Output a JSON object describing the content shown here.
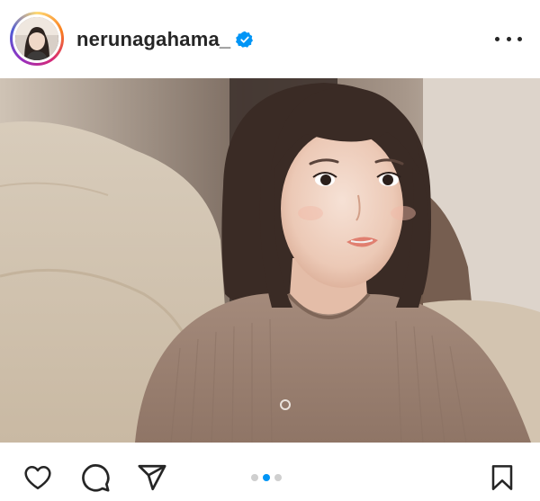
{
  "post": {
    "username": "nerunagahama_",
    "verified": true,
    "avatar_icon": "profile-avatar",
    "more_icon": "more-options-icon",
    "photo_description_icon": "post-photo"
  },
  "actions": {
    "like_icon": "heart-icon",
    "comment_icon": "comment-icon",
    "share_icon": "paper-plane-icon",
    "save_icon": "bookmark-icon"
  },
  "carousel": {
    "total": 3,
    "active_index": 1,
    "active_color": "#0095f6",
    "inactive_color": "#cfcfcf"
  },
  "colors": {
    "text": "#262626",
    "verified_blue": "#0095f6"
  }
}
